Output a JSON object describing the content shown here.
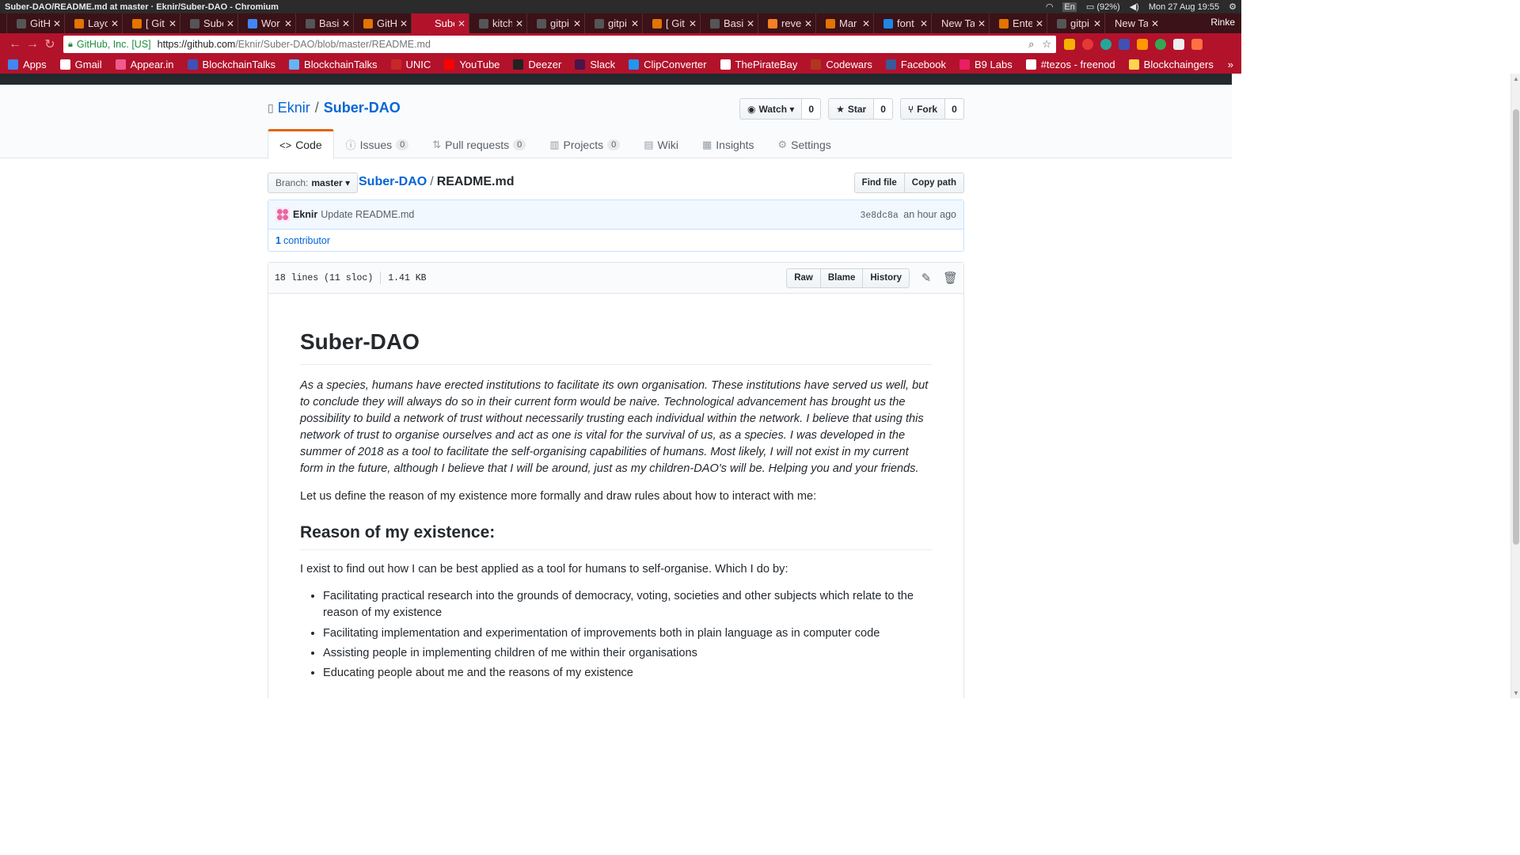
{
  "os": {
    "window_title": "Suber-DAO/README.md at master · Eknir/Suber-DAO - Chromium",
    "keyboard": "En",
    "battery": "(92%)",
    "datetime": "Mon 27 Aug 19:55"
  },
  "browser": {
    "user": "Rinke",
    "tabs": [
      {
        "label": "GitH",
        "color": "#555"
      },
      {
        "label": "Layo",
        "color": "#e37400"
      },
      {
        "label": "[ Git",
        "color": "#e37400"
      },
      {
        "label": "Sube",
        "color": "#555"
      },
      {
        "label": "Wor",
        "color": "#4285f4"
      },
      {
        "label": "Basi",
        "color": "#555"
      },
      {
        "label": "GitH",
        "color": "#e37400"
      },
      {
        "label": "Sube",
        "color": "#b3122b",
        "active": true
      },
      {
        "label": "kitch",
        "color": "#555"
      },
      {
        "label": "gitpi",
        "color": "#555"
      },
      {
        "label": "gitpi",
        "color": "#555"
      },
      {
        "label": "[ Git",
        "color": "#e37400"
      },
      {
        "label": "Basi",
        "color": "#555"
      },
      {
        "label": "reve",
        "color": "#f48024"
      },
      {
        "label": "Mar",
        "color": "#e37400"
      },
      {
        "label": "font",
        "color": "#1e88e5"
      },
      {
        "label": "New Ta",
        "color": ""
      },
      {
        "label": "Ente",
        "color": "#e37400"
      },
      {
        "label": "gitpi",
        "color": "#555"
      },
      {
        "label": "New Ta",
        "color": ""
      }
    ],
    "url_site_id": "GitHub, Inc. [US]",
    "url_host": "https://github.com",
    "url_path": "/Eknir/Suber-DAO/blob/master/README.md",
    "bookmarks": [
      {
        "label": "Apps",
        "color": "#4285f4"
      },
      {
        "label": "Gmail",
        "color": "#ffffff"
      },
      {
        "label": "Appear.in",
        "color": "#f05a8d"
      },
      {
        "label": "BlockchainTalks",
        "color": "#3f51b5"
      },
      {
        "label": "BlockchainTalks",
        "color": "#64b5f6"
      },
      {
        "label": "UNIC",
        "color": "#c62828"
      },
      {
        "label": "YouTube",
        "color": "#ff0000"
      },
      {
        "label": "Deezer",
        "color": "#222222"
      },
      {
        "label": "Slack",
        "color": "#4a154b"
      },
      {
        "label": "ClipConverter",
        "color": "#2196f3"
      },
      {
        "label": "ThePirateBay",
        "color": "#ffffff"
      },
      {
        "label": "Codewars",
        "color": "#b1361e"
      },
      {
        "label": "Facebook",
        "color": "#3b5998"
      },
      {
        "label": "B9 Labs",
        "color": "#e91e63"
      },
      {
        "label": "#tezos - freenod",
        "color": "#ffffff"
      },
      {
        "label": "Blockchaingers",
        "color": "#ffd54f"
      }
    ]
  },
  "repo": {
    "owner": "Eknir",
    "name": "Suber-DAO",
    "watch_label": "Watch",
    "watch_count": "0",
    "star_label": "Star",
    "star_count": "0",
    "fork_label": "Fork",
    "fork_count": "0",
    "nav": {
      "code": "Code",
      "issues": "Issues",
      "issues_count": "0",
      "pulls": "Pull requests",
      "pulls_count": "0",
      "projects": "Projects",
      "projects_count": "0",
      "wiki": "Wiki",
      "insights": "Insights",
      "settings": "Settings"
    }
  },
  "file": {
    "branch_label": "Branch:",
    "branch": "master",
    "repo_crumb": "Suber-DAO",
    "filename": "README.md",
    "find_file": "Find file",
    "copy_path": "Copy path",
    "commit_author": "Eknir",
    "commit_message": "Update README.md",
    "commit_sha": "3e8dc8a",
    "commit_time": "an hour ago",
    "contributors_count": "1",
    "contributors_label": "contributor",
    "lines": "18 lines (11 sloc)",
    "size": "1.41 KB",
    "raw": "Raw",
    "blame": "Blame",
    "history": "History"
  },
  "readme": {
    "title": "Suber-DAO",
    "intro": "As a species, humans have erected institutions to facilitate its own organisation. These institutions have served us well, but to conclude they will always do so in their current form would be naive. Technological advancement has brought us the possibility to build a network of trust without necessarily trusting each individual within the network. I believe that using this network of trust to organise ourselves and act as one is vital for the survival of us, as a species. I was developed in the summer of 2018 as a tool to facilitate the self-organising capabilities of humans. Most likely, I will not exist in my current form in the future, although I believe that I will be around, just as my children-DAO's will be. Helping you and your friends.",
    "para2": "Let us define the reason of my existence more formally and draw rules about how to interact with me:",
    "h2": "Reason of my existence:",
    "para3": "I exist to find out how I can be best applied as a tool for humans to self-organise. Which I do by:",
    "items": [
      "Facilitating practical research into the grounds of democracy, voting, societies and other subjects which relate to the reason of my existence",
      "Facilitating implementation and experimentation of improvements both in plain language as in computer code",
      "Assisting people in implementing children of me within their organisations",
      "Educating people about me and the reasons of my existence"
    ]
  }
}
